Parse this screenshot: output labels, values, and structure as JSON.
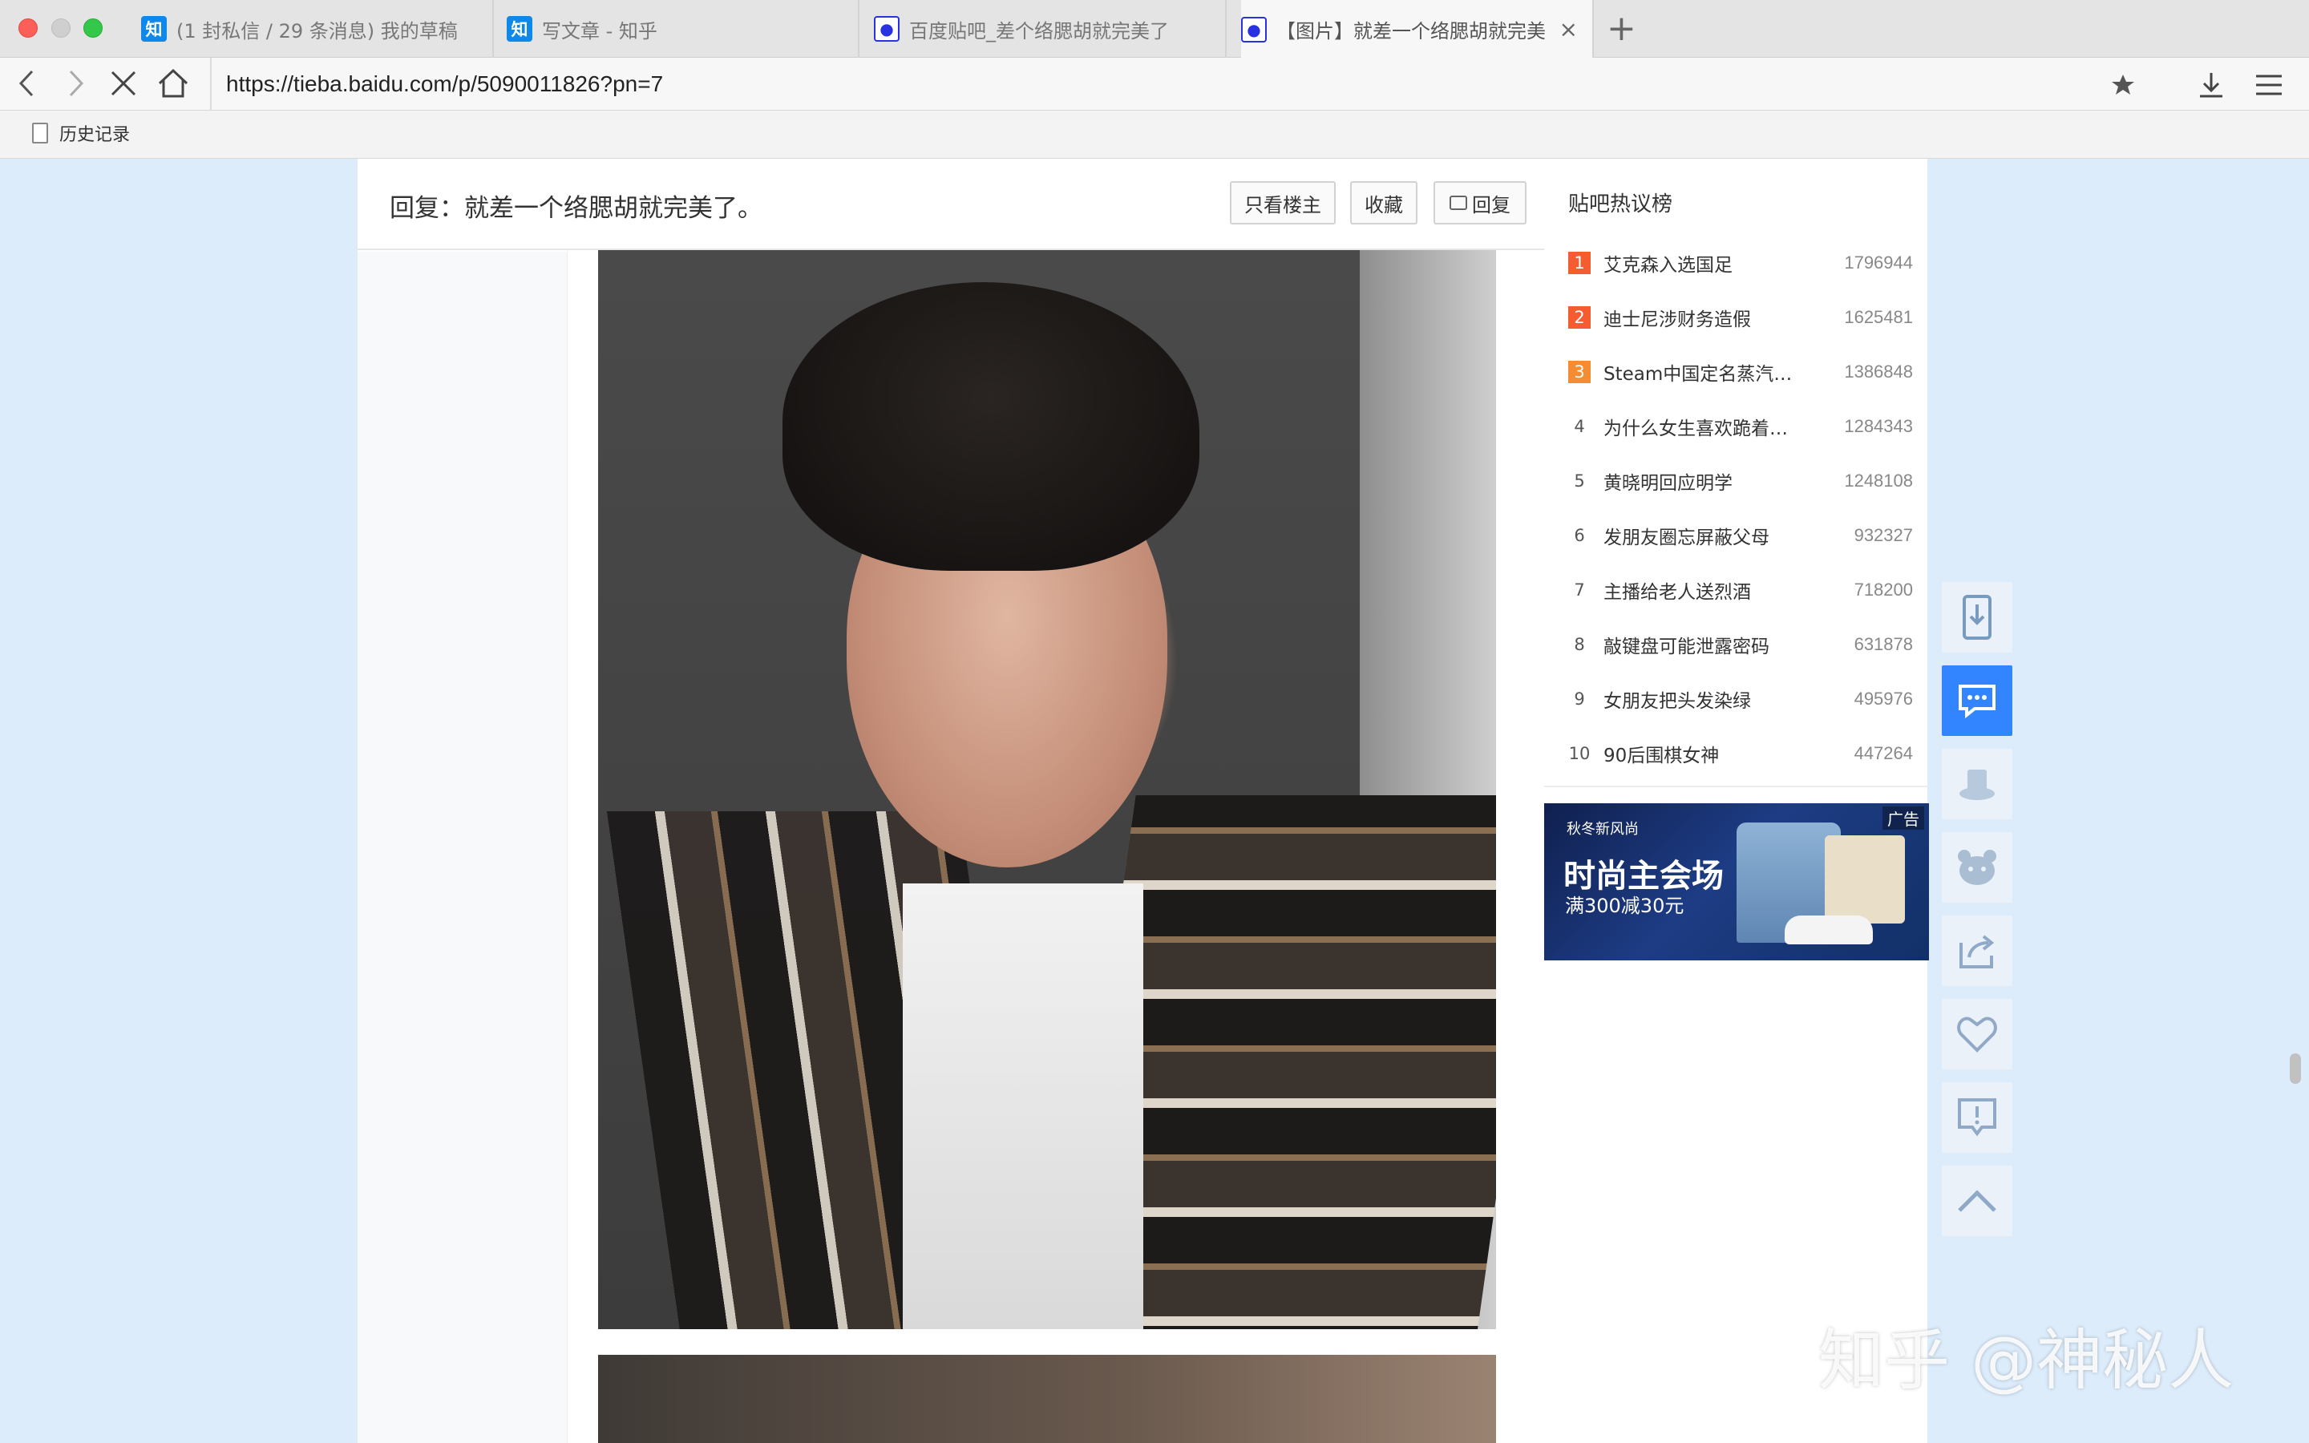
{
  "tabs": [
    {
      "title": "(1 封私信 / 29 条消息) 我的草稿",
      "favicon": "知",
      "active": false
    },
    {
      "title": "写文章 - 知乎",
      "favicon": "知",
      "active": false
    },
    {
      "title": "百度贴吧_差个络腮胡就完美了",
      "favicon": "paw-icon",
      "active": false
    },
    {
      "title": "【图片】就差一个络腮胡就完美",
      "favicon": "paw-icon",
      "active": true
    }
  ],
  "address": {
    "url": "https://tieba.baidu.com/p/5090011826?pn=7"
  },
  "bookmarks": [
    {
      "label": "历史记录"
    }
  ],
  "post": {
    "title": "回复：就差一个络腮胡就完美了。",
    "buttons": {
      "only_op": "只看楼主",
      "favorite": "收藏",
      "reply": "回复"
    }
  },
  "hot": {
    "title": "贴吧热议榜",
    "items": [
      {
        "rank": "1",
        "name": "艾克森入选国足",
        "count": "1796944"
      },
      {
        "rank": "2",
        "name": "迪士尼涉财务造假",
        "count": "1625481"
      },
      {
        "rank": "3",
        "name": "Steam中国定名蒸汽…",
        "count": "1386848"
      },
      {
        "rank": "4",
        "name": "为什么女生喜欢跪着…",
        "count": "1284343"
      },
      {
        "rank": "5",
        "name": "黄晓明回应明学",
        "count": "1248108"
      },
      {
        "rank": "6",
        "name": "发朋友圈忘屏蔽父母",
        "count": "932327"
      },
      {
        "rank": "7",
        "name": "主播给老人送烈酒",
        "count": "718200"
      },
      {
        "rank": "8",
        "name": "敲键盘可能泄露密码",
        "count": "631878"
      },
      {
        "rank": "9",
        "name": "女朋友把头发染绿",
        "count": "495976"
      },
      {
        "rank": "10",
        "name": "90后围棋女神",
        "count": "447264"
      }
    ]
  },
  "ad": {
    "badge": "广告",
    "subtitle": "秋冬新风尚",
    "headline": "时尚主会场",
    "deal": "满300减30元"
  },
  "watermark": "知乎 @神秘人",
  "colors": {
    "accent": "#3385ff",
    "rank_top": "#f55c2f",
    "page_bg": "#dcecfb"
  },
  "icons": {
    "float": [
      "phone-download-icon",
      "chat-icon",
      "hat-icon",
      "bear-icon",
      "share-icon",
      "heart-icon",
      "report-icon",
      "back-to-top-icon"
    ]
  }
}
